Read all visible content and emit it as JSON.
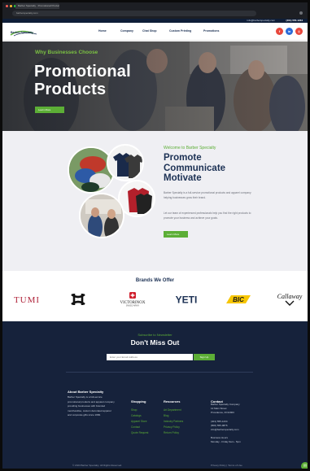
{
  "browser": {
    "tab_title": "Barber Specialty · Promotional Products",
    "url": "barberspecialty.com"
  },
  "topbar": {
    "email": "info@barberspecialty.com",
    "phone": "(401) 555-1234"
  },
  "header": {
    "logo_text": "Barber Specialty",
    "nav": [
      "Home",
      "Company",
      "Chat Shop",
      "Custom Printing",
      "Promotions"
    ],
    "socials": [
      {
        "name": "facebook",
        "glyph": "f",
        "color": "#e8473c"
      },
      {
        "name": "linkedin",
        "glyph": "in",
        "color": "#2a6bd9"
      },
      {
        "name": "instagram",
        "glyph": "◎",
        "color": "#e8473c"
      }
    ]
  },
  "hero": {
    "eyebrow": "Why Businesses Choose",
    "title_line1": "Promotional",
    "title_line2": "Products",
    "button": "Learn More"
  },
  "welcome": {
    "eyebrow": "Welcome to Barber Specialty",
    "title_lines": [
      "Promote",
      "Communicate",
      "Motivate"
    ],
    "paragraph1": "Barber Specialty is a full-service promotional products and apparel company helping businesses grow their brand.",
    "paragraph2": "Let our team of experienced professionals help you find the right products to promote your business and achieve your goals.",
    "button": "Learn More"
  },
  "brands": {
    "title": "Brands We Offer",
    "logos": [
      "TUMI",
      "Under Armour",
      "VICTORINOX",
      "YETI",
      "BIC",
      "Callaway"
    ]
  },
  "newsletter": {
    "eyebrow": "Subscribe to Newsletter",
    "title": "Don't Miss Out",
    "placeholder": "Enter your Email Address",
    "button": "Sign Up"
  },
  "footer": {
    "about_title": "About Barber Specialty",
    "about_text": "Barber Specialty is a full-service promotional products and apparel company providing businesses with branded merchandise, custom decorated apparel and corporate gifts since 1982.",
    "col_shopping": {
      "title": "Shopping",
      "items": [
        "Shop",
        "Catalogs",
        "Apparel Store",
        "Contact",
        "Quote Request"
      ]
    },
    "col_resources": {
      "title": "Resources",
      "items": [
        "Art Department",
        "Blog",
        "Industry Partners",
        "Privacy Policy",
        "Return Policy"
      ]
    },
    "col_contact": {
      "title": "Contact",
      "lines": [
        "Barber Specialty Company",
        "12 Main Street",
        "Providence, RI 02903",
        "",
        "(401) 555-1234",
        "(800) 555-9876",
        "info@barberspecialty.com",
        "",
        "Business Hours",
        "Monday - Friday 9am - 5pm"
      ]
    },
    "copyright": "© 2023 Barber Specialty. All Rights Reserved.",
    "credit": "Privacy Policy  |  Terms of Use"
  }
}
